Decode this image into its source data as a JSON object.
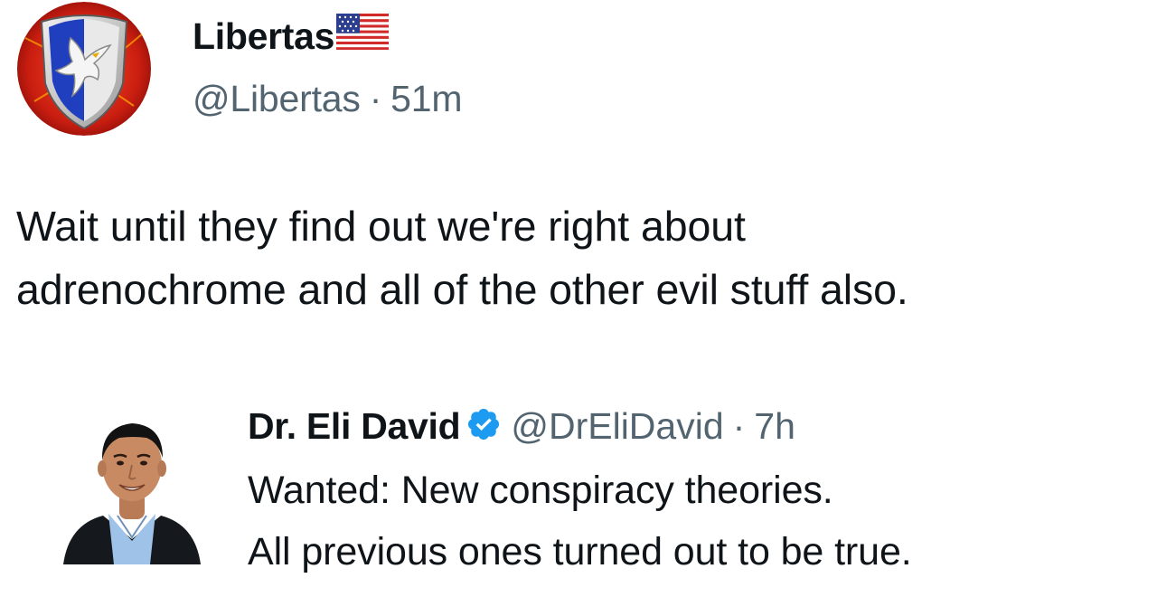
{
  "post": {
    "display_name": "Libertas",
    "name_emoji_icon": "us-flag-icon",
    "handle": "@Libertas",
    "separator": "·",
    "time_ago": "51m",
    "avatar_icon": "eagle-shield-avatar",
    "text_lines": [
      "Wait until they find out we're right about",
      "adrenochrome and all of the other evil stuff also."
    ]
  },
  "quoted_post": {
    "display_name": "Dr. Eli David",
    "verified_icon": "verified-badge-icon",
    "handle": "@DrEliDavid",
    "separator": "·",
    "time_ago": "7h",
    "text_lines": [
      "Wanted: New conspiracy theories.",
      "All previous ones turned out to be true."
    ]
  },
  "colors": {
    "text_primary": "#0f1419",
    "text_secondary": "#536471",
    "verified_blue": "#1d9bf0",
    "background": "#ffffff"
  }
}
